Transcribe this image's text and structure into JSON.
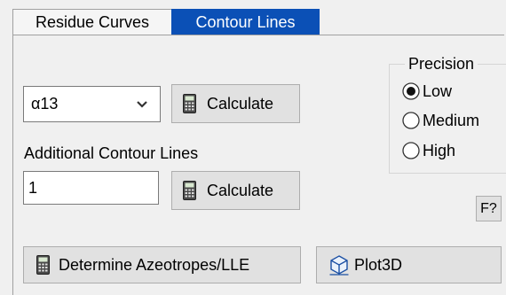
{
  "tabs": [
    {
      "label": "Residue Curves",
      "active": false
    },
    {
      "label": "Contour Lines",
      "active": true
    }
  ],
  "contour": {
    "selected_variable": "α13",
    "calculate_label": "Calculate"
  },
  "additional": {
    "label": "Additional Contour Lines",
    "value": "1",
    "calculate_label": "Calculate"
  },
  "precision": {
    "title": "Precision",
    "options": [
      {
        "label": "Low",
        "checked": true
      },
      {
        "label": "Medium",
        "checked": false
      },
      {
        "label": "High",
        "checked": false
      }
    ]
  },
  "help_label": "F?",
  "buttons": {
    "determine_label": "Determine Azeotropes/LLE",
    "plot_label": "Plot3D"
  },
  "colors": {
    "active_tab": "#0b50b6",
    "background": "#f0f0f0"
  },
  "icons": [
    "calculator-icon",
    "chevron-down-icon",
    "cube-3d-icon"
  ]
}
